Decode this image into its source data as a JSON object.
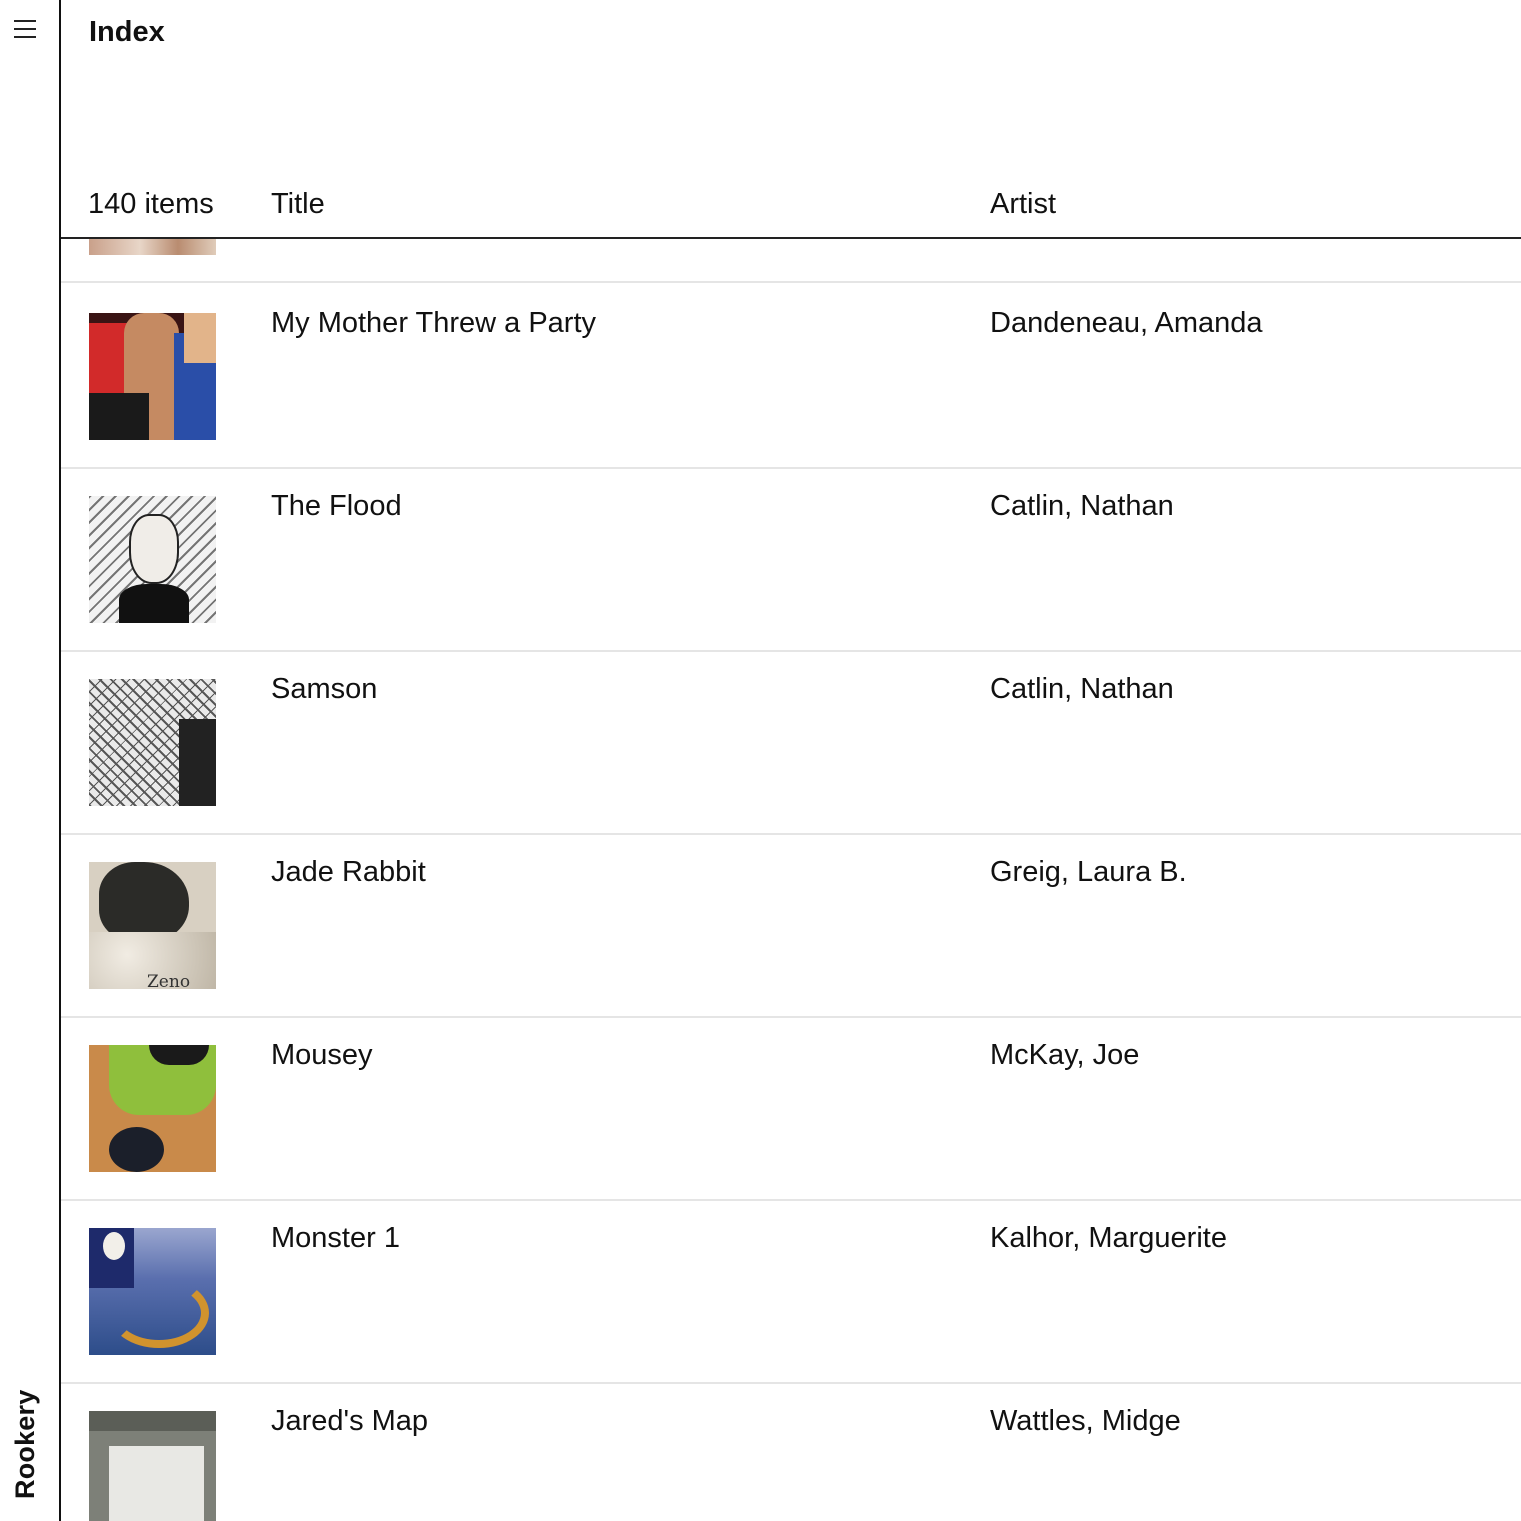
{
  "app": {
    "brand": "Rookery"
  },
  "header": {
    "title": "Index"
  },
  "table": {
    "count_label": "140 items",
    "col_title": "Title",
    "col_artist": "Artist"
  },
  "rows": [
    {
      "title": "My Mother Threw a Party",
      "artist": "Dandeneau, Amanda"
    },
    {
      "title": "The Flood",
      "artist": "Catlin, Nathan"
    },
    {
      "title": "Samson",
      "artist": "Catlin, Nathan"
    },
    {
      "title": "Jade Rabbit",
      "artist": "Greig, Laura B.",
      "thumb_text": "Zeno"
    },
    {
      "title": "Mousey",
      "artist": "McKay, Joe"
    },
    {
      "title": "Monster 1",
      "artist": "Kalhor, Marguerite"
    },
    {
      "title": "Jared's Map",
      "artist": "Wattles, Midge"
    }
  ],
  "icons": {
    "menu": "hamburger-menu-icon"
  }
}
